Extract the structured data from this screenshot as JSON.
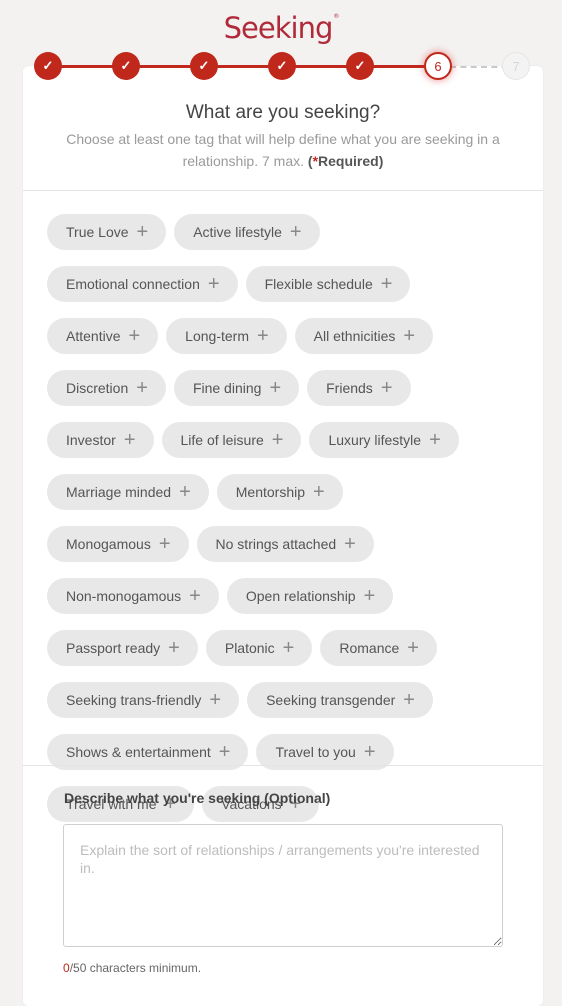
{
  "brand": {
    "logo_text": "Seeking",
    "logo_mark": "®",
    "accent_color": "#c0281c"
  },
  "stepper": {
    "steps": [
      {
        "label": "✓",
        "state": "done"
      },
      {
        "label": "✓",
        "state": "done"
      },
      {
        "label": "✓",
        "state": "done"
      },
      {
        "label": "✓",
        "state": "done"
      },
      {
        "label": "✓",
        "state": "done"
      },
      {
        "label": "6",
        "state": "current"
      },
      {
        "label": "7",
        "state": "todo"
      }
    ]
  },
  "header": {
    "title": "What are you seeking?",
    "subtitle": "Choose at least one tag that will help define what you are seeking in a relationship. 7 max.",
    "required_open": "(",
    "required_star": "*",
    "required_text": "Required)"
  },
  "tags": {
    "add_icon": "+",
    "items": [
      "True Love",
      "Active lifestyle",
      "Emotional connection",
      "Flexible schedule",
      "Attentive",
      "Long-term",
      "All ethnicities",
      "Discretion",
      "Fine dining",
      "Friends",
      "Investor",
      "Life of leisure",
      "Luxury lifestyle",
      "Marriage minded",
      "Mentorship",
      "Monogamous",
      "No strings attached",
      "Non-monogamous",
      "Open relationship",
      "Passport ready",
      "Platonic",
      "Romance",
      "Seeking trans-friendly",
      "Seeking transgender",
      "Shows & entertainment",
      "Travel to you",
      "Travel with me",
      "Vacations"
    ]
  },
  "description": {
    "label": "Describe what you're seeking (Optional)",
    "value": "",
    "placeholder": "Explain the sort of relationships / arrangements you're interested in.",
    "count_current": "0",
    "count_rest": "/50 characters minimum."
  }
}
